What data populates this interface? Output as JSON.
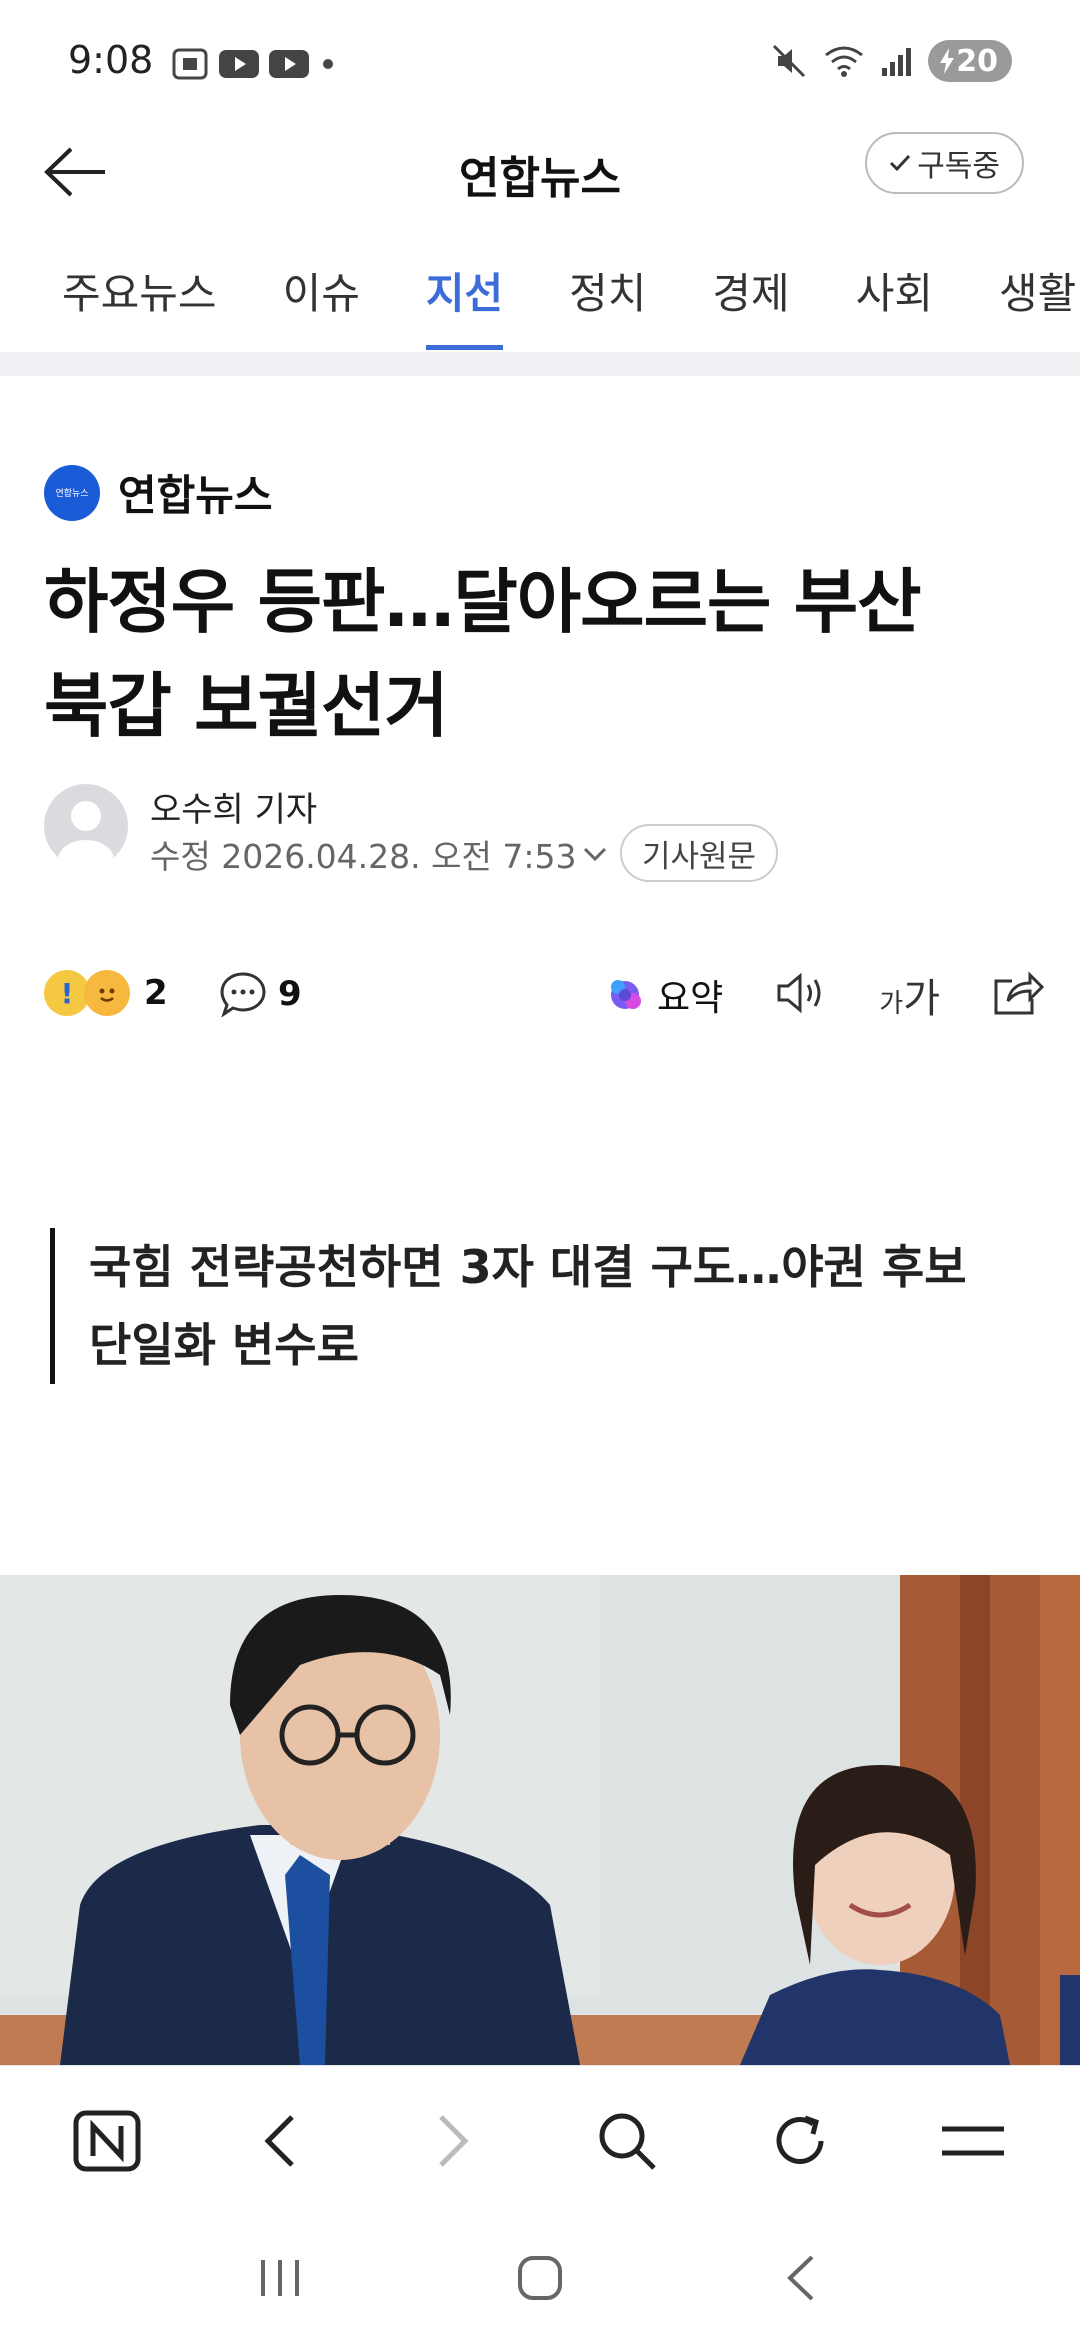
{
  "status_bar": {
    "time": "9:08",
    "battery": "20"
  },
  "app_bar": {
    "title": "연합뉴스",
    "subscribe_label": "구독중"
  },
  "tabs": [
    {
      "label": "주요뉴스",
      "active": false
    },
    {
      "label": "이슈",
      "active": false
    },
    {
      "label": "지선",
      "active": true
    },
    {
      "label": "정치",
      "active": false
    },
    {
      "label": "경제",
      "active": false
    },
    {
      "label": "사회",
      "active": false
    },
    {
      "label": "생활",
      "active": false
    }
  ],
  "article": {
    "press_name": "연합뉴스",
    "press_logo_text": "연합뉴스",
    "headline_line1": "하정우 등판…달아오르는 부산",
    "headline_line2": "북갑 보궐선거",
    "reporter": "오수희 기자",
    "modified": "수정 2026.04.28. 오전 7:53",
    "origin_button": "기사원문",
    "reaction_count": "2",
    "comment_count": "9",
    "summary_label": "요약",
    "font_label_small": "가",
    "font_label_large": "가",
    "subheadline": "국힘 전략공천하면 3자 대결 구도…야권 후보 단일화 변수로"
  },
  "colors": {
    "accent": "#3b6cd8",
    "press_logo": "#1a5bd8"
  }
}
